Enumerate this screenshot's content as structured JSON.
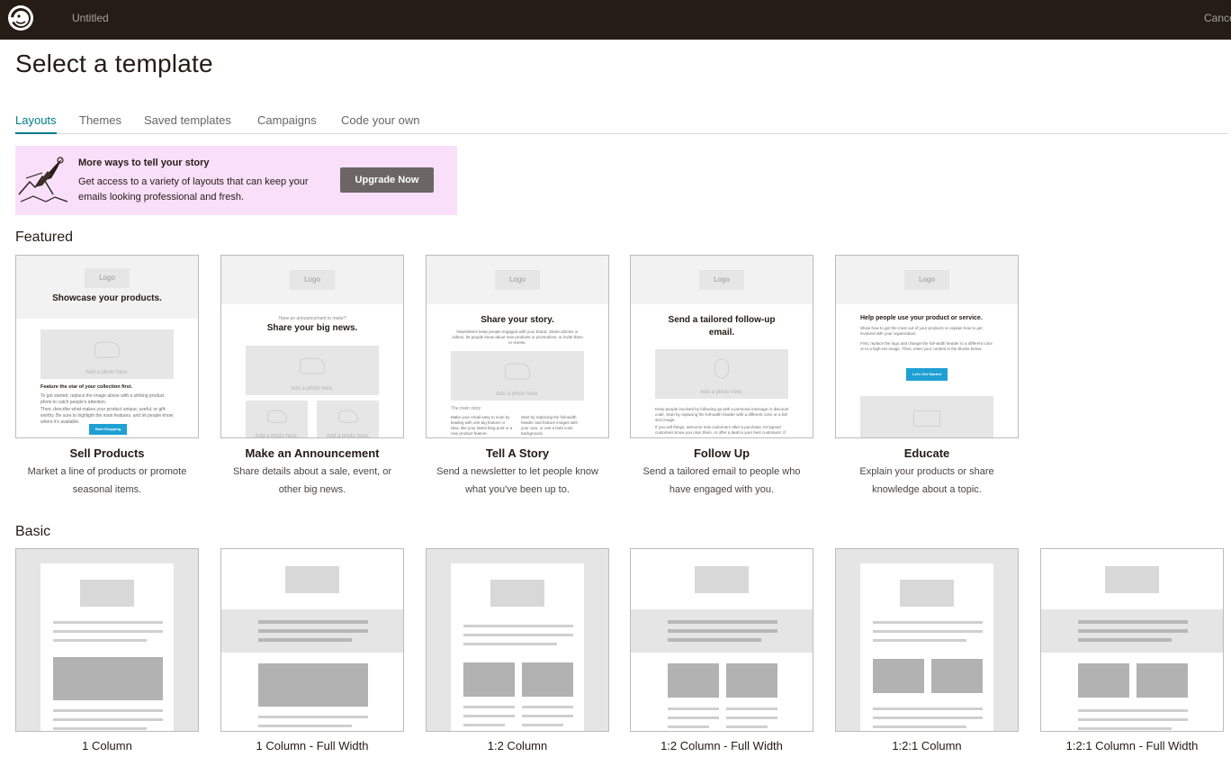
{
  "app": {
    "title": "Untitled",
    "cancel_label": "Cancel",
    "brand_icon": "mailchimp-freddie-logo"
  },
  "page": {
    "title": "Select a template"
  },
  "tabs": [
    {
      "label": "Layouts",
      "active": true
    },
    {
      "label": "Themes",
      "active": false
    },
    {
      "label": "Saved templates",
      "active": false
    },
    {
      "label": "Campaigns",
      "active": false
    },
    {
      "label": "Code your own",
      "active": false
    }
  ],
  "banner": {
    "title": "More ways to tell your story",
    "body": "Get access to a variety of layouts that can keep your emails looking professional and fresh.",
    "button": "Upgrade Now",
    "background": "#f9dff9"
  },
  "featured": {
    "title": "Featured",
    "cards": [
      {
        "name": "Sell Products",
        "description": "Market a line of products or promote seasonal items.",
        "thumb": {
          "logo": "Logo",
          "headline": "Showcase your products.",
          "photo_text": "Add a photo here.",
          "subhead": "Feature the star of your collection first.",
          "body1": "To get started, replace the image above with a striking product photo to catch people's attention.",
          "body2": "Then, describe what makes your product unique, useful, or gift-worthy. Be sure to highlight the main features, and let people know where it's available.",
          "button": "Start Shopping"
        }
      },
      {
        "name": "Make an Announcement",
        "description": "Share details about a sale, event, or other big news.",
        "thumb": {
          "logo": "Logo",
          "kicker": "Have an announcement to make?",
          "headline": "Share your big news.",
          "photo_text": "Add a photo here."
        }
      },
      {
        "name": "Tell A Story",
        "description": "Send a newsletter to let people know what you've been up to.",
        "thumb": {
          "logo": "Logo",
          "headline": "Share your story.",
          "intro": "Newsletters keep people engaged with your brand. Share articles or videos, let people know about new products or promotions, or invite them to events.",
          "photo_text": "Add a photo here.",
          "kicker": "The main story",
          "col1": "Make your email easy to scan by leading with one big feature or idea, like your latest blog post or a new product feature.",
          "col2": "Start by replacing the full-width header and feature images with your own, or use a bold color background."
        }
      },
      {
        "name": "Follow Up",
        "description": "Send a tailored email to people who have engaged with you.",
        "thumb": {
          "logo": "Logo",
          "headline": "Send a tailored follow-up email.",
          "photo_text": "Add a photo here.",
          "body1": "Keep people involved by following up with a personal message or discount code. Start by replacing the full-width header with a different color or a full-size image.",
          "body2": "If you sell things, welcome new customers after a purchase, let lapsed customers know you miss them, or offer a deal to your best customers. If"
        }
      },
      {
        "name": "Educate",
        "description": "Explain your products or share knowledge about a topic.",
        "thumb": {
          "logo": "Logo",
          "headline": "Help people use your product or service.",
          "body1": "Show how to get the most out of your products or explain how to get involved with your organization.",
          "body2": "First, replace the logo and change the full-width header to a different color or to a high-res image. Then, enter your content in the blocks below.",
          "button": "Let's Get Started"
        }
      }
    ]
  },
  "basic": {
    "title": "Basic",
    "cards": [
      {
        "name": "1 Column"
      },
      {
        "name": "1 Column - Full Width"
      },
      {
        "name": "1:2 Column"
      },
      {
        "name": "1:2 Column - Full Width"
      },
      {
        "name": "1:2:1 Column"
      },
      {
        "name": "1:2:1 Column - Full Width"
      }
    ]
  },
  "colors": {
    "accent": "#007c89",
    "topbar": "#241c15",
    "cta": "#1ea0d4"
  }
}
